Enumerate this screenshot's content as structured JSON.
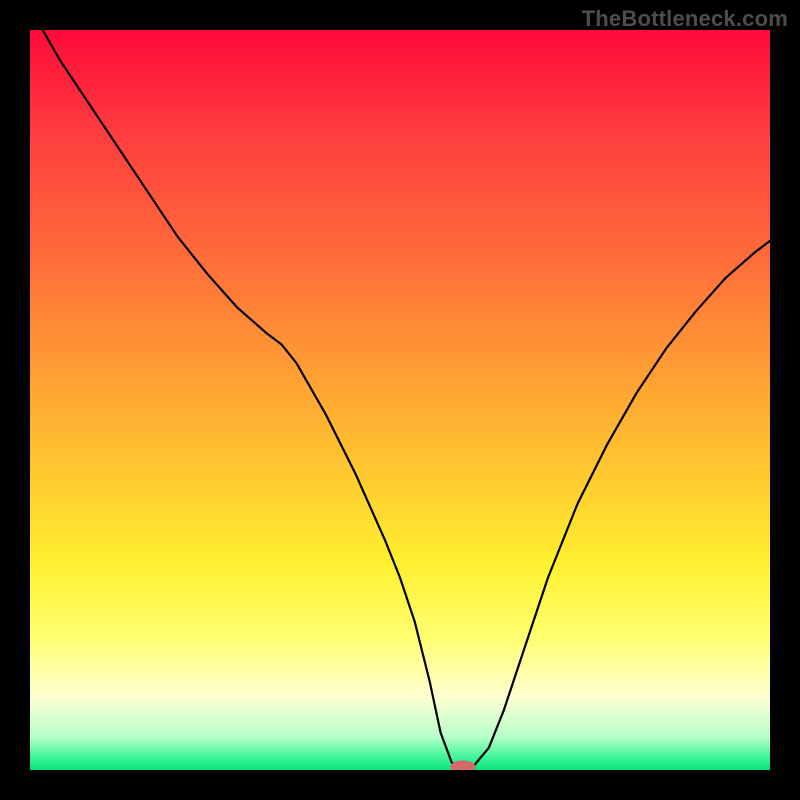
{
  "watermark": "TheBottleneck.com",
  "chart_data": {
    "type": "line",
    "title": "",
    "xlabel": "",
    "ylabel": "",
    "xlim": [
      0,
      100
    ],
    "ylim": [
      0,
      100
    ],
    "gradient_stops": [
      {
        "offset": 0.0,
        "color": "#ff0b3a"
      },
      {
        "offset": 0.14,
        "color": "#ff3d3f"
      },
      {
        "offset": 0.3,
        "color": "#ff6a3a"
      },
      {
        "offset": 0.45,
        "color": "#ff9a34"
      },
      {
        "offset": 0.6,
        "color": "#ffc92f"
      },
      {
        "offset": 0.72,
        "color": "#fff02f"
      },
      {
        "offset": 0.82,
        "color": "#ffff70"
      },
      {
        "offset": 0.9,
        "color": "#ffffd0"
      },
      {
        "offset": 0.955,
        "color": "#b8ffcc"
      },
      {
        "offset": 0.98,
        "color": "#4cf79e"
      },
      {
        "offset": 1.0,
        "color": "#05e47c"
      }
    ],
    "series": [
      {
        "name": "bottleneck-curve",
        "x": [
          0,
          4,
          8,
          12,
          16,
          20,
          24,
          28,
          32,
          34,
          36,
          40,
          44,
          48,
          50,
          52,
          54,
          55.5,
          57,
          58,
          59,
          60,
          62,
          64,
          66,
          68,
          70,
          74,
          78,
          82,
          86,
          90,
          94,
          98,
          100
        ],
        "y": [
          103,
          96,
          90,
          84,
          78,
          72,
          67,
          62.5,
          59,
          57.5,
          55,
          48,
          40,
          31,
          26,
          20,
          12,
          5,
          1,
          0.3,
          0.3,
          0.6,
          3,
          8,
          14,
          20,
          26,
          36,
          44,
          51,
          57,
          62,
          66.5,
          70,
          71.5
        ]
      }
    ],
    "marker": {
      "x": 58.5,
      "y": 0.4,
      "rx": 1.7,
      "ry": 0.9,
      "color": "#d46a6a"
    }
  }
}
